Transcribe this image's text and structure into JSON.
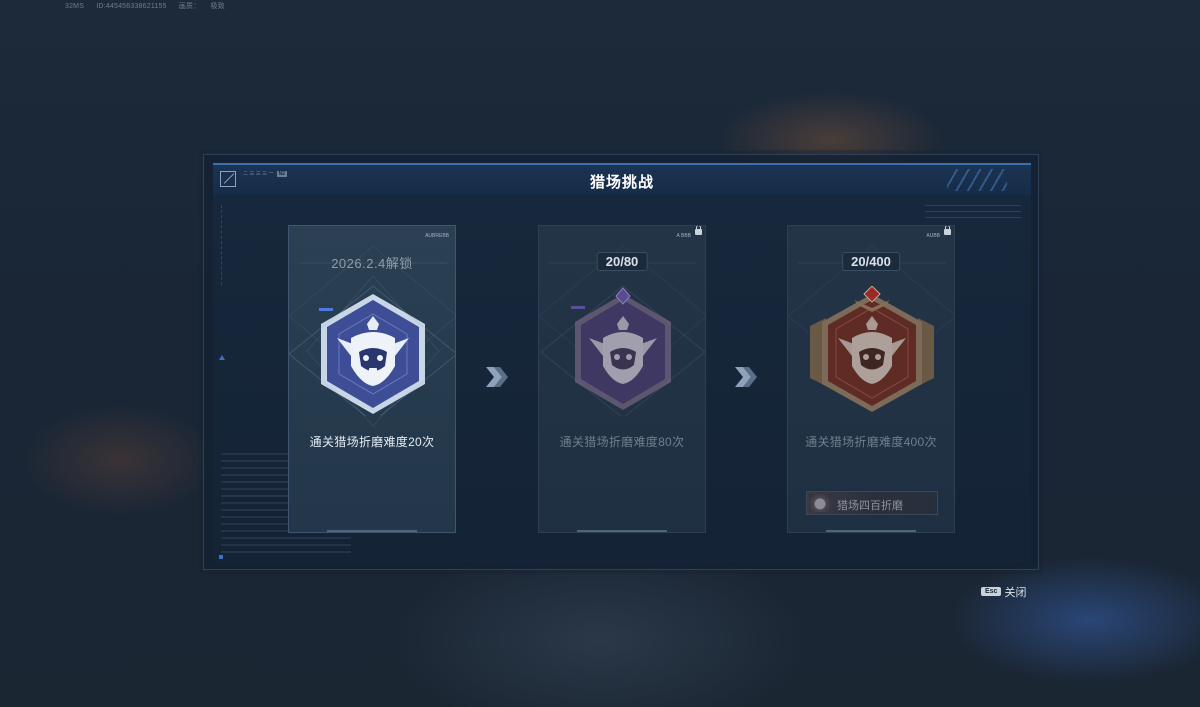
{
  "top_info": {
    "ping": "32MS",
    "id": "ID:445456338621155",
    "quality_label": "画质：",
    "quality_value": "极致"
  },
  "header": {
    "title": "猎场挑战",
    "code_line1": "二 三 三 三 一",
    "code_tag": "N2"
  },
  "cards": [
    {
      "id": 1,
      "state": "active",
      "top_text": "2026.2.4解锁",
      "progress_current": null,
      "progress_total": null,
      "description": "通关猎场折磨难度20次",
      "badge_tier": "silver-blue",
      "tag": "AUBREBB"
    },
    {
      "id": 2,
      "state": "locked",
      "top_text": null,
      "progress_current": "20",
      "progress_total": "80",
      "description": "通关猎场折磨难度80次",
      "badge_tier": "purple",
      "tag": "A BBB"
    },
    {
      "id": 3,
      "state": "locked",
      "top_text": null,
      "progress_current": "20",
      "progress_total": "400",
      "description": "通关猎场折磨难度400次",
      "badge_tier": "bronze",
      "tag": "AUBB",
      "reward_label": "猎场四百折磨"
    }
  ],
  "arrows": [
    "next-arrow",
    "next-arrow"
  ],
  "footer": {
    "esc_key": "Esc",
    "close_label": "关闭"
  },
  "colors": {
    "accent": "#3b6fb0",
    "panel": "#132132",
    "badge_blue": "#3c4f9e",
    "badge_purple": "#4a3f7a",
    "badge_bronze": "#7a3a30"
  }
}
